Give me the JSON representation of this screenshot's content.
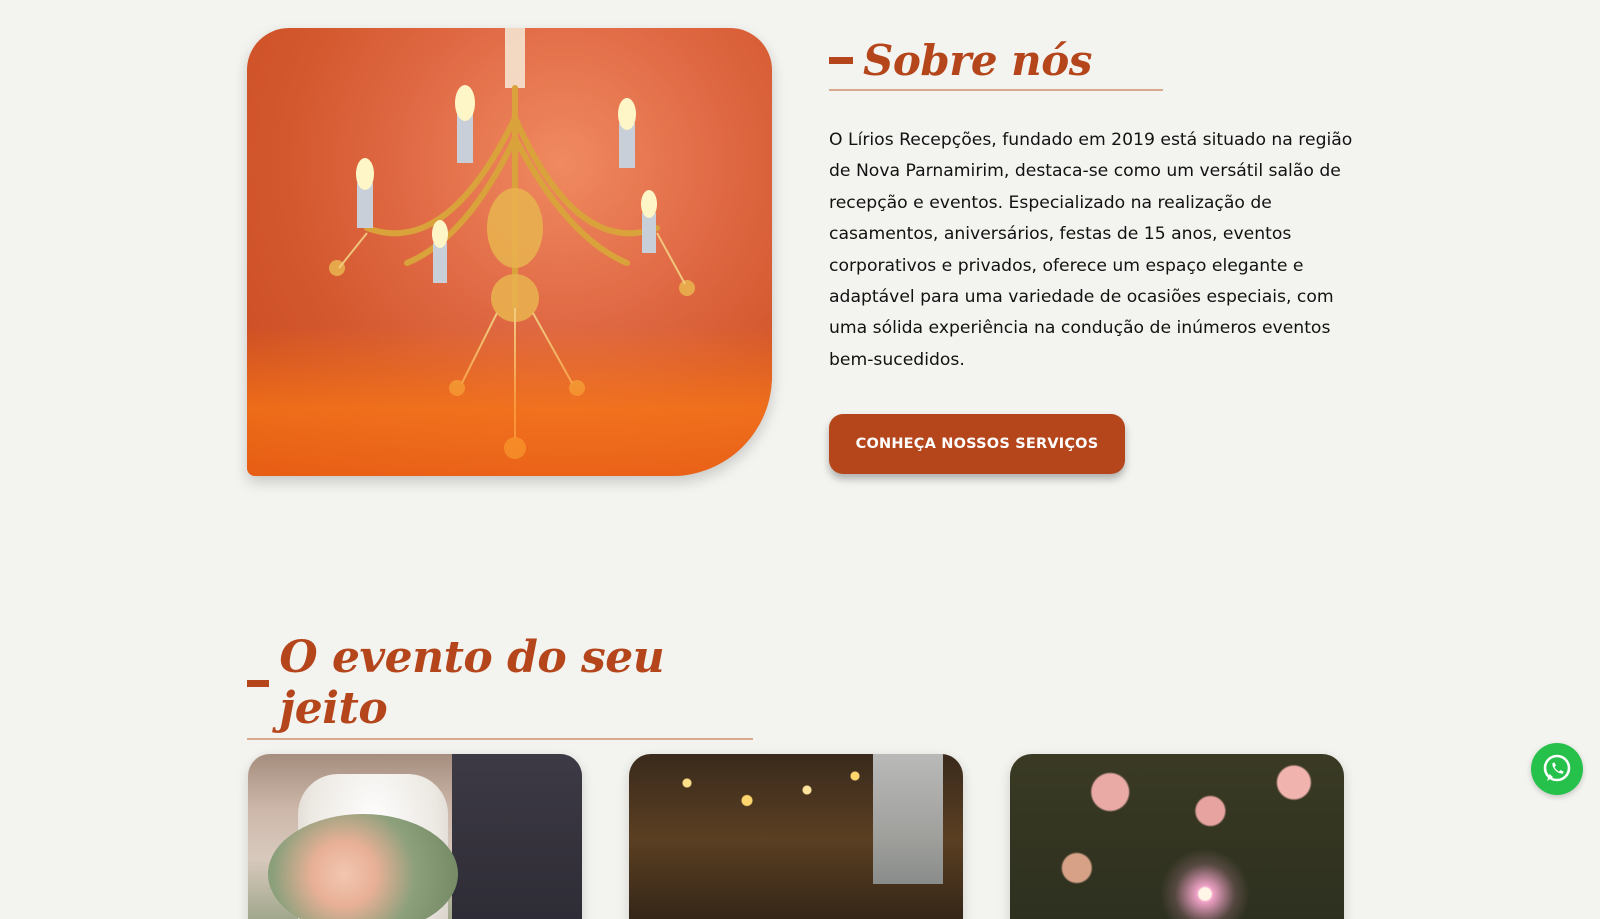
{
  "about": {
    "title": "Sobre nós",
    "paragraph": "O Lírios Recepções, fundado em 2019 está situado na região de Nova Parnamirim, destaca-se como um versátil salão de recepção e eventos. Especializado na realização de casamentos, aniversários, festas de 15 anos, eventos corporativos e privados, oferece um espaço elegante e adaptável para uma variedade de ocasiões especiais, com uma sólida experiência na condução de inúmeros eventos bem-sucedidos.",
    "cta_label": "CONHEÇA NOSSOS SERVIÇOS",
    "image_icon": "chandelier-photo"
  },
  "events": {
    "title": "O evento do seu jeito",
    "cards": [
      {
        "icon": "wedding-couple-photo"
      },
      {
        "icon": "party-celebration-photo"
      },
      {
        "icon": "sparkler-photo"
      }
    ]
  },
  "floating": {
    "icon": "whatsapp-icon"
  },
  "colors": {
    "brand": "#b5461c",
    "background": "#f3f3ef",
    "whatsapp": "#25c14b"
  }
}
